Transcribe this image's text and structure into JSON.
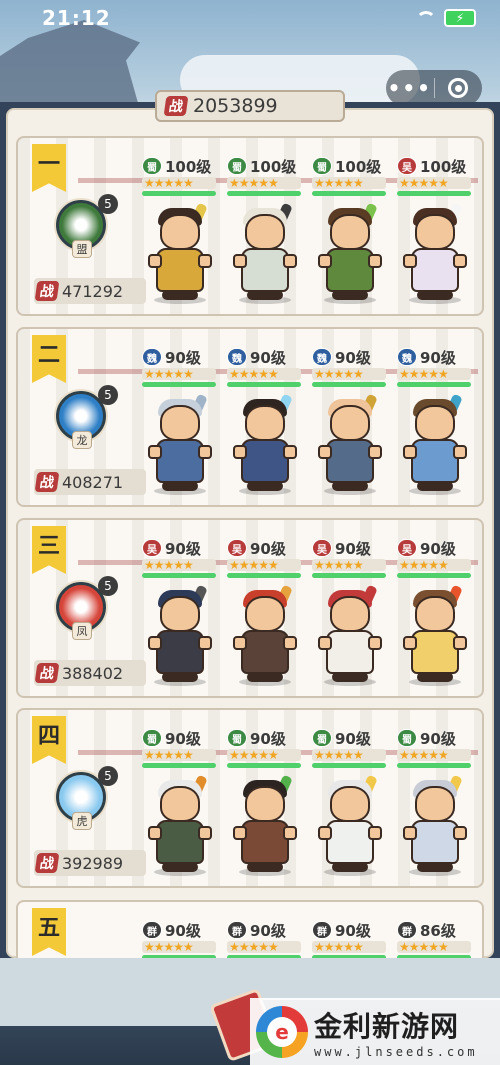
{
  "status_bar": {
    "time": "21:12"
  },
  "total_power": {
    "badge": "战",
    "value": "2053899"
  },
  "teams": [
    {
      "rank": "一",
      "emblem": {
        "name": "盟",
        "level": "5",
        "color": "#3f7a3c"
      },
      "power_badge": "战",
      "power": "471292",
      "heroes": [
        {
          "faction": "蜀",
          "faction_color": "#3d8a44",
          "level": "100级",
          "stars": "★★★★★",
          "hp": 1.0,
          "armor": "#d8a83a",
          "hair": "#3a2a22",
          "weapon": "#e6c64a"
        },
        {
          "faction": "蜀",
          "faction_color": "#3d8a44",
          "level": "100级",
          "stars": "★★★★★",
          "hp": 1.0,
          "armor": "#d6ddd2",
          "hair": "#e9e4d8",
          "weapon": "#3c3c3c"
        },
        {
          "faction": "蜀",
          "faction_color": "#3d8a44",
          "level": "100级",
          "stars": "★★★★★",
          "hp": 1.0,
          "armor": "#5f8a3e",
          "hair": "#5a3b24",
          "weapon": "#7bc24c"
        },
        {
          "faction": "吴",
          "faction_color": "#b83b3b",
          "level": "100级",
          "stars": "★★★★★",
          "hp": 1.0,
          "armor": "#e9e1f0",
          "hair": "#4b2f22",
          "weapon": "#f6f6f6"
        }
      ]
    },
    {
      "rank": "二",
      "emblem": {
        "name": "龙",
        "level": "5",
        "color": "#2e7fc6"
      },
      "power_badge": "战",
      "power": "408271",
      "heroes": [
        {
          "faction": "魏",
          "faction_color": "#2f5f9e",
          "level": "90级",
          "stars": "★★★★★",
          "hp": 1.0,
          "armor": "#4c6d9f",
          "hair": "#c6d0da",
          "weapon": "#9fb4c8"
        },
        {
          "faction": "魏",
          "faction_color": "#2f5f9e",
          "level": "90级",
          "stars": "★★★★★",
          "hp": 1.0,
          "armor": "#3f5585",
          "hair": "#2e2520",
          "weapon": "#8fd4f0"
        },
        {
          "faction": "魏",
          "faction_color": "#2f5f9e",
          "level": "90级",
          "stars": "★★★★★",
          "hp": 1.0,
          "armor": "#556b8a",
          "hair": "#f0c49a",
          "weapon": "#d0a336"
        },
        {
          "faction": "魏",
          "faction_color": "#2f5f9e",
          "level": "90级",
          "stars": "★★★★★",
          "hp": 1.0,
          "armor": "#6c9bd0",
          "hair": "#6a4a2c",
          "weapon": "#3fa3c9"
        }
      ]
    },
    {
      "rank": "三",
      "emblem": {
        "name": "凤",
        "level": "5",
        "color": "#d6453a"
      },
      "power_badge": "战",
      "power": "388402",
      "heroes": [
        {
          "faction": "吴",
          "faction_color": "#b83b3b",
          "level": "90级",
          "stars": "★★★★★",
          "hp": 1.0,
          "armor": "#3c3c46",
          "hair": "#2d3a58",
          "weapon": "#555555"
        },
        {
          "faction": "吴",
          "faction_color": "#b83b3b",
          "level": "90级",
          "stars": "★★★★★",
          "hp": 1.0,
          "armor": "#5a4238",
          "hair": "#c8402c",
          "weapon": "#e6a23c"
        },
        {
          "faction": "吴",
          "faction_color": "#b83b3b",
          "level": "90级",
          "stars": "★★★★★",
          "hp": 1.0,
          "armor": "#f2eee8",
          "hair": "#c23a3a",
          "weapon": "#c23a3a"
        },
        {
          "faction": "吴",
          "faction_color": "#b83b3b",
          "level": "90级",
          "stars": "★★★★★",
          "hp": 1.0,
          "armor": "#f1cf6a",
          "hair": "#7a5030",
          "weapon": "#e8542c"
        }
      ]
    },
    {
      "rank": "四",
      "emblem": {
        "name": "虎",
        "level": "5",
        "color": "#8ac9ef"
      },
      "power_badge": "战",
      "power": "392989",
      "heroes": [
        {
          "faction": "蜀",
          "faction_color": "#3d8a44",
          "level": "90级",
          "stars": "★★★★★",
          "hp": 1.0,
          "armor": "#4b5c44",
          "hair": "#e9e9e9",
          "weapon": "#e28d2c"
        },
        {
          "faction": "蜀",
          "faction_color": "#3d8a44",
          "level": "90级",
          "stars": "★★★★★",
          "hp": 1.0,
          "armor": "#7a4a36",
          "hair": "#2c2420",
          "weapon": "#54b04a"
        },
        {
          "faction": "蜀",
          "faction_color": "#3d8a44",
          "level": "90级",
          "stars": "★★★★★",
          "hp": 1.0,
          "armor": "#eef1ee",
          "hair": "#e8e8e8",
          "weapon": "#f2c84a"
        },
        {
          "faction": "蜀",
          "faction_color": "#3d8a44",
          "level": "90级",
          "stars": "★★★★★",
          "hp": 1.0,
          "armor": "#cfd8e6",
          "hair": "#c7ccd6",
          "weapon": "#f2c84a"
        }
      ]
    },
    {
      "rank": "五",
      "emblem": {
        "name": "",
        "level": "",
        "color": "#888888"
      },
      "power_badge": "",
      "power": "",
      "heroes": [
        {
          "faction": "群",
          "faction_color": "#3c3c3c",
          "level": "90级",
          "stars": "★★★★★",
          "hp": 1.0,
          "armor": "#777777",
          "hair": "#333333",
          "weapon": "#777777"
        },
        {
          "faction": "群",
          "faction_color": "#3c3c3c",
          "level": "90级",
          "stars": "★★★★★",
          "hp": 1.0,
          "armor": "#777777",
          "hair": "#333333",
          "weapon": "#777777"
        },
        {
          "faction": "群",
          "faction_color": "#3c3c3c",
          "level": "90级",
          "stars": "★★★★★",
          "hp": 1.0,
          "armor": "#777777",
          "hair": "#333333",
          "weapon": "#777777"
        },
        {
          "faction": "群",
          "faction_color": "#3c3c3c",
          "level": "86级",
          "stars": "★★★★★",
          "hp": 1.0,
          "armor": "#777777",
          "hair": "#333333",
          "weapon": "#777777"
        }
      ]
    }
  ],
  "watermark": {
    "logo_letter": "e",
    "title": "金利新游网",
    "url": "www.jlnseeds.com"
  }
}
